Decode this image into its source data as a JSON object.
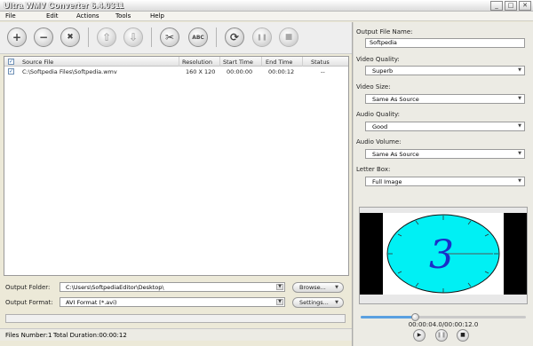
{
  "window": {
    "title": "Ultra WMV Converter 6.4.0311",
    "controls": [
      "minimize-icon",
      "maximize-icon",
      "close-icon"
    ]
  },
  "menu": [
    "File",
    "Edit",
    "Actions",
    "Tools",
    "Help"
  ],
  "toolbar": {
    "buttons": [
      {
        "name": "add-icon",
        "glyph": "+",
        "enabled": true
      },
      {
        "name": "remove-icon",
        "glyph": "−",
        "enabled": true
      },
      {
        "name": "clear-icon",
        "glyph": "✖",
        "enabled": true
      },
      {
        "name": "move-up-icon",
        "glyph": "⇧",
        "enabled": false
      },
      {
        "name": "move-down-icon",
        "glyph": "⇩",
        "enabled": false
      },
      {
        "name": "cut-icon",
        "glyph": "✂",
        "enabled": true
      },
      {
        "name": "abc-icon",
        "glyph": "ABC",
        "enabled": true
      },
      {
        "name": "convert-icon",
        "glyph": "⟳",
        "enabled": true
      },
      {
        "name": "pause-icon",
        "glyph": "❚❚",
        "enabled": false
      },
      {
        "name": "stop-icon",
        "glyph": "■",
        "enabled": false
      }
    ]
  },
  "file_list": {
    "columns": [
      "Source File",
      "Resolution",
      "Start Time",
      "End Time",
      "Status"
    ],
    "rows": [
      {
        "checked": true,
        "source": "C:\\Softpedia Files\\Softpedia.wmv",
        "resolution": "160 X 120",
        "start": "00:00:00",
        "end": "00:00:12",
        "status": "--"
      }
    ]
  },
  "output": {
    "folder_label": "Output Folder:",
    "folder_value": "C:\\Users\\SoftpediaEditor\\Desktop\\",
    "browse_label": "Browse...",
    "format_label": "Output Format:",
    "format_value": "AVI Format (*.avi)",
    "settings_label": "Settings..."
  },
  "status": {
    "files": "Files Number:1",
    "duration": "Total Duration:00:00:12"
  },
  "settings_panel": {
    "file_name_label": "Output File Name:",
    "file_name_value": "Softpedia",
    "video_quality_label": "Video Quality:",
    "video_quality_value": "Superb",
    "video_size_label": "Video Size:",
    "video_size_value": "Same As Source",
    "audio_quality_label": "Audio Quality:",
    "audio_quality_value": "Good",
    "audio_volume_label": "Audio Volume:",
    "audio_volume_value": "Same As Source",
    "letter_box_label": "Letter Box:",
    "letter_box_value": "Full Image"
  },
  "preview": {
    "frame_digit": "3",
    "timecode": "00:00:04.0/00:00:12.0",
    "progress_fraction": 0.33,
    "controls": [
      "play-icon",
      "pause-icon",
      "stop-icon"
    ]
  },
  "colors": {
    "clock_face": "#00f0f4",
    "clock_digit": "#1a2ec8",
    "letterbox": "#000000"
  }
}
